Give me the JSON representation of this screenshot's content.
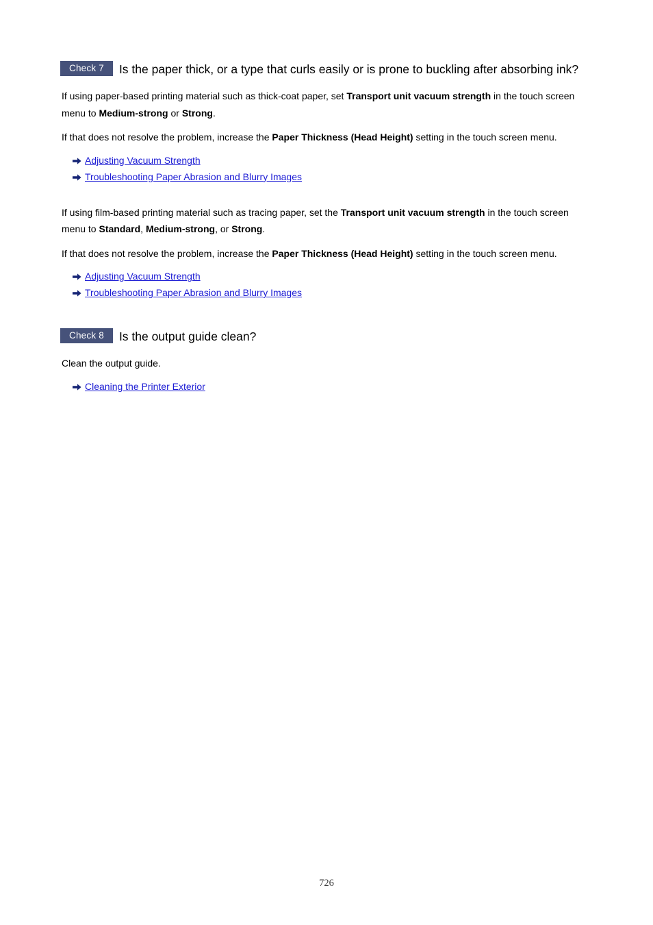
{
  "document": {
    "page_number": "726",
    "link_color": "#1b1bd4",
    "badge_color": "#46527a",
    "badge_text_color": "#ffffff",
    "background_color": "#ffffff",
    "arrow_icon_color": "#152475"
  },
  "sections": [
    {
      "badge": "Check 7",
      "title": "Is the paper thick, or a type that curls easily or is prone to buckling after absorbing ink?",
      "paragraphs": [
        {
          "runs": [
            {
              "text": "If using paper-based printing material such as thick-coat paper, set ",
              "bold": false
            },
            {
              "text": "Transport unit vacuum strength",
              "bold": true
            },
            {
              "text": " in the touch screen menu to ",
              "bold": false
            },
            {
              "text": "Medium-strong",
              "bold": true
            },
            {
              "text": " or ",
              "bold": false
            },
            {
              "text": "Strong",
              "bold": true
            },
            {
              "text": ".",
              "bold": false
            }
          ]
        },
        {
          "runs": [
            {
              "text": "If that does not resolve the problem, increase the ",
              "bold": false
            },
            {
              "text": "Paper Thickness (Head Height)",
              "bold": true
            },
            {
              "text": " setting in the touch screen menu.",
              "bold": false
            }
          ]
        }
      ],
      "links": [
        {
          "label": "Adjusting Vacuum Strength",
          "icon": "arrow-right-icon"
        },
        {
          "label": "Troubleshooting Paper Abrasion and Blurry Images",
          "icon": "arrow-right-icon"
        }
      ],
      "paragraphs2": [
        {
          "runs": [
            {
              "text": "If using film-based printing material such as tracing paper, set the ",
              "bold": false
            },
            {
              "text": "Transport unit vacuum strength",
              "bold": true
            },
            {
              "text": " in the touch screen menu to ",
              "bold": false
            },
            {
              "text": "Standard",
              "bold": true
            },
            {
              "text": ", ",
              "bold": false
            },
            {
              "text": "Medium-strong",
              "bold": true
            },
            {
              "text": ", or ",
              "bold": false
            },
            {
              "text": "Strong",
              "bold": true
            },
            {
              "text": ".",
              "bold": false
            }
          ]
        },
        {
          "runs": [
            {
              "text": "If that does not resolve the problem, increase the ",
              "bold": false
            },
            {
              "text": "Paper Thickness (Head Height)",
              "bold": true
            },
            {
              "text": " setting in the touch screen menu.",
              "bold": false
            }
          ]
        }
      ],
      "links2": [
        {
          "label": "Adjusting Vacuum Strength",
          "icon": "arrow-right-icon"
        },
        {
          "label": "Troubleshooting Paper Abrasion and Blurry Images",
          "icon": "arrow-right-icon"
        }
      ]
    },
    {
      "badge": "Check 8",
      "title": "Is the output guide clean?",
      "paragraphs": [
        {
          "runs": [
            {
              "text": "Clean the output guide.",
              "bold": false
            }
          ]
        }
      ],
      "links": [
        {
          "label": "Cleaning the Printer Exterior",
          "icon": "arrow-right-icon"
        }
      ]
    }
  ]
}
